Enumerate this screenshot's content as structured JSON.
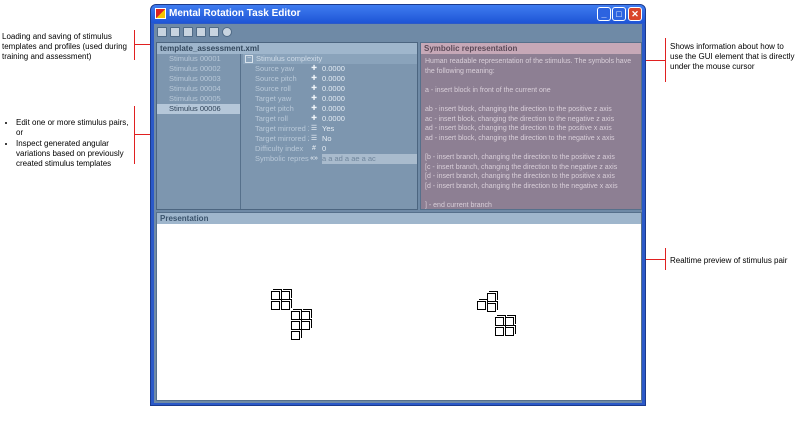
{
  "annotations": {
    "loading": "Loading and saving of stimulus templates and profiles (used during training and assessment)",
    "edit_items": [
      "Edit one or more stimulus pairs, or",
      "Inspect generated angular variations based on previously created stimulus templates"
    ],
    "info": "Shows information about how to use the GUI element that is directly under the mouse cursor",
    "preview": "Realtime preview of stimulus pair"
  },
  "window": {
    "title": "Mental Rotation Task Editor",
    "minimize": "_",
    "maximize": "□",
    "close": "✕"
  },
  "toolbar": [
    "new-icon",
    "open-icon",
    "save-icon",
    "copy-icon",
    "paste-icon",
    "settings-icon"
  ],
  "template": {
    "file_name": "template_assessment.xml",
    "stimuli": [
      "Stimulus 00001",
      "Stimulus 00002",
      "Stimulus 00003",
      "Stimulus 00004",
      "Stimulus 00005",
      "Stimulus 00006"
    ],
    "category": "Stimulus complexity",
    "properties": [
      {
        "name": "Source yaw",
        "icon": "✚",
        "value": "0.0000"
      },
      {
        "name": "Source pitch",
        "icon": "✚",
        "value": "0.0000"
      },
      {
        "name": "Source roll",
        "icon": "✚",
        "value": "0.0000"
      },
      {
        "name": "Target yaw",
        "icon": "✚",
        "value": "0.0000"
      },
      {
        "name": "Target pitch",
        "icon": "✚",
        "value": "0.0000"
      },
      {
        "name": "Target roll",
        "icon": "✚",
        "value": "0.0000"
      },
      {
        "name": "Target mirrored X",
        "icon": "☰",
        "value": "Yes"
      },
      {
        "name": "Target mirrored Z",
        "icon": "☰",
        "value": "No"
      },
      {
        "name": "Difficulty index",
        "icon": "#",
        "value": "0"
      },
      {
        "name": "Symbolic represent",
        "icon": "«»",
        "value": "a a ad a ae a ac"
      }
    ]
  },
  "symbolic": {
    "title": "Symbolic representation",
    "lines": [
      "Human readable representation of the stimulus. The symbols have",
      "the following meaning:",
      "",
      "a - insert block in front of the current one",
      "",
      "ab - insert block, changing the direction to the positive z axis",
      "ac - insert block, changing the direction to the negative z axis",
      "ad - insert block, changing the direction to the positive x axis",
      "ad - insert block, changing the direction to the negative x axis",
      "",
      "[b - insert branch, changing the direction to the positive z axis",
      "[c - insert branch, changing the direction to the negative z axis",
      "[d - insert branch, changing the direction to the positive x axis",
      "[d - insert branch, changing the direction to the negative x axis",
      "",
      "] - end current branch"
    ]
  },
  "presentation": {
    "title": "Presentation"
  }
}
